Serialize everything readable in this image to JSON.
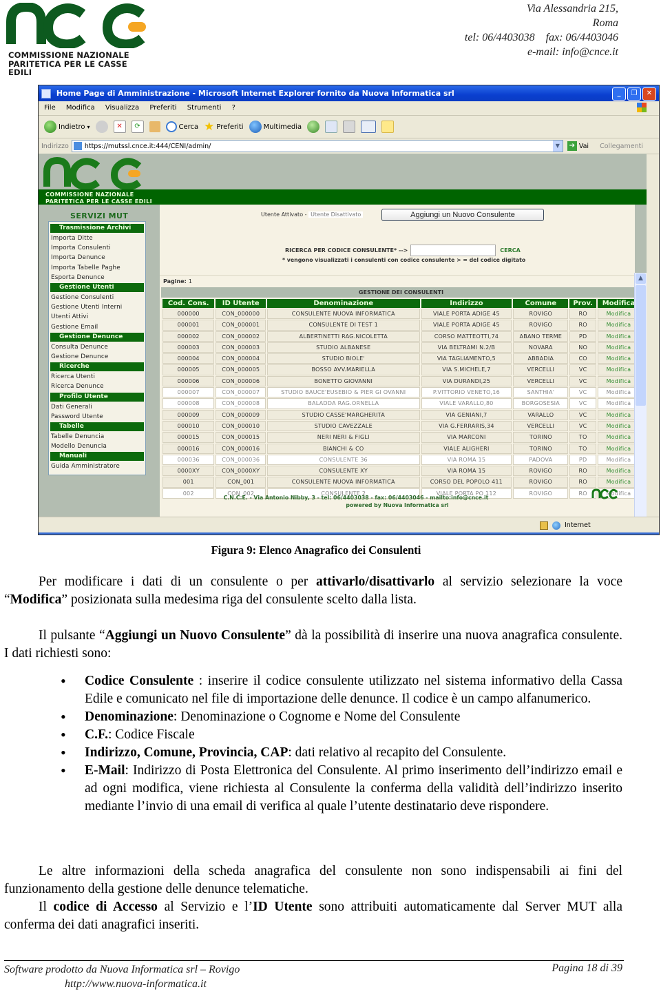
{
  "letterhead": {
    "org_line1": "COMMISSIONE NAZIONALE",
    "org_line2": "PARITETICA PER LE CASSE EDILI",
    "address_line1": "Via Alessandria 215,",
    "address_line2": "Roma",
    "phone_fax": "tel: 06/4403038    fax: 06/4403046",
    "email": "e-mail: info@cnce.it"
  },
  "browser": {
    "title": "Home Page di Amministrazione - Microsoft Internet Explorer fornito da Nuova Informatica srl",
    "menu": [
      "File",
      "Modifica",
      "Visualizza",
      "Preferiti",
      "Strumenti",
      "?"
    ],
    "toolbar": {
      "back": "Indietro",
      "search": "Cerca",
      "favorites": "Preferiti",
      "media": "Multimedia"
    },
    "address_label": "Indirizzo",
    "url": "https://mutssl.cnce.it:444/CENI/admin/",
    "go": "Vai",
    "links": "Collegamenti",
    "status_zone": "Internet"
  },
  "site": {
    "org_line1": "COMMISSIONE NAZIONALE",
    "org_line2": "PARITETICA PER LE CASSE EDILI",
    "sidebar_title": "SERVIZI MUT",
    "sidebar": [
      {
        "type": "head",
        "label": "Trasmissione Archivi"
      },
      {
        "type": "item",
        "label": "Importa Ditte"
      },
      {
        "type": "item",
        "label": "Importa Consulenti"
      },
      {
        "type": "item",
        "label": "Importa Denunce"
      },
      {
        "type": "item",
        "label": "Importa Tabelle Paghe"
      },
      {
        "type": "item",
        "label": "Esporta Denunce"
      },
      {
        "type": "head",
        "label": "Gestione Utenti"
      },
      {
        "type": "item",
        "label": "Gestione Consulenti"
      },
      {
        "type": "item",
        "label": "Gestione Utenti Interni"
      },
      {
        "type": "item",
        "label": "Utenti Attivi"
      },
      {
        "type": "item",
        "label": "Gestione Email"
      },
      {
        "type": "head",
        "label": "Gestione Denunce"
      },
      {
        "type": "item",
        "label": "Consulta Denunce"
      },
      {
        "type": "item",
        "label": "Gestione Denunce"
      },
      {
        "type": "head",
        "label": "Ricerche"
      },
      {
        "type": "item",
        "label": "Ricerca Utenti"
      },
      {
        "type": "item",
        "label": "Ricerca Denunce"
      },
      {
        "type": "head",
        "label": "Profilo Utente"
      },
      {
        "type": "item",
        "label": "Dati Generali"
      },
      {
        "type": "item",
        "label": "Password Utente"
      },
      {
        "type": "head",
        "label": "Tabelle"
      },
      {
        "type": "item",
        "label": "Tabelle Denuncia"
      },
      {
        "type": "item",
        "label": "Modello Denuncia"
      },
      {
        "type": "head",
        "label": "Manuali"
      },
      {
        "type": "item",
        "label": "Guida Amministratore"
      }
    ],
    "legend_active": "Utente Attivato",
    "legend_sep": " - ",
    "legend_inactive": "Utente Disattivato",
    "add_button": "Aggiungi un Nuovo Consulente",
    "search_label": "RICERCA PER CODICE CONSULENTE* -->",
    "search_value": "",
    "search_button": "CERCA",
    "search_note": "* vengono visualizzati i consulenti con codice consulente > = del codice digitato",
    "pages_label": "Pagine:",
    "pages_value": "1",
    "table_title": "GESTIONE DEI CONSULENTI",
    "columns": [
      "Cod. Cons.",
      "ID Utente",
      "Denominazione",
      "Indirizzo",
      "Comune",
      "Prov.",
      "Modifica"
    ],
    "rows": [
      {
        "active": true,
        "cells": [
          "000000",
          "CON_000000",
          "CONSULENTE NUOVA INFORMATICA",
          "VIALE PORTA ADIGE 45",
          "ROVIGO",
          "RO",
          "Modifica"
        ]
      },
      {
        "active": true,
        "cells": [
          "000001",
          "CON_000001",
          "CONSULENTE DI TEST 1",
          "VIALE PORTA ADIGE 45",
          "ROVIGO",
          "RO",
          "Modifica"
        ]
      },
      {
        "active": true,
        "cells": [
          "000002",
          "CON_000002",
          "ALBERTINETTI RAG.NICOLETTA",
          "CORSO MATTEOTTI,74",
          "ABANO TERME",
          "PD",
          "Modifica"
        ]
      },
      {
        "active": true,
        "cells": [
          "000003",
          "CON_000003",
          "STUDIO ALBANESE",
          "VIA BELTRAMI N.2/B",
          "NOVARA",
          "NO",
          "Modifica"
        ]
      },
      {
        "active": true,
        "cells": [
          "000004",
          "CON_000004",
          "STUDIO BIOLE'",
          "VIA TAGLIAMENTO,5",
          "ABBADIA",
          "CO",
          "Modifica"
        ]
      },
      {
        "active": true,
        "cells": [
          "000005",
          "CON_000005",
          "BOSSO AVV.MARIELLA",
          "VIA S.MICHELE,7",
          "VERCELLI",
          "VC",
          "Modifica"
        ]
      },
      {
        "active": true,
        "cells": [
          "000006",
          "CON_000006",
          "BONETTO GIOVANNI",
          "VIA DURANDI,25",
          "VERCELLI",
          "VC",
          "Modifica"
        ]
      },
      {
        "active": false,
        "cells": [
          "000007",
          "CON_000007",
          "STUDIO BAUCE'EUSEBIO & PIER GI OVANNI",
          "P.VITTORIO VENETO,16",
          "SANTHIA'",
          "VC",
          "Modifica"
        ]
      },
      {
        "active": false,
        "cells": [
          "000008",
          "CON_000008",
          "BALADDA RAG.ORNELLA",
          "VIALE VARALLO,80",
          "BORGOSESIA",
          "VC",
          "Modifica"
        ]
      },
      {
        "active": true,
        "cells": [
          "000009",
          "CON_000009",
          "STUDIO CASSE'MARGHERITA",
          "VIA GENIANI,7",
          "VARALLO",
          "VC",
          "Modifica"
        ]
      },
      {
        "active": true,
        "cells": [
          "000010",
          "CON_000010",
          "STUDIO CAVEZZALE",
          "VIA G.FERRARIS,34",
          "VERCELLI",
          "VC",
          "Modifica"
        ]
      },
      {
        "active": true,
        "cells": [
          "000015",
          "CON_000015",
          "NERI NERI & FIGLI",
          "VIA MARCONI",
          "TORINO",
          "TO",
          "Modifica"
        ]
      },
      {
        "active": true,
        "cells": [
          "000016",
          "CON_000016",
          "BIANCHI & CO",
          "VIALE ALIGHERI",
          "TORINO",
          "TO",
          "Modifica"
        ]
      },
      {
        "active": false,
        "cells": [
          "000036",
          "CON_000036",
          "CONSULENTE 36",
          "VIA ROMA 15",
          "PADOVA",
          "PD",
          "Modifica"
        ]
      },
      {
        "active": true,
        "cells": [
          "0000XY",
          "CON_0000XY",
          "CONSULENTE XY",
          "VIA ROMA 15",
          "ROVIGO",
          "RO",
          "Modifica"
        ]
      },
      {
        "active": true,
        "cells": [
          "001",
          "CON_001",
          "CONSULENTE NUOVA INFORMATICA",
          "CORSO DEL POPOLO 411",
          "ROVIGO",
          "RO",
          "Modifica"
        ]
      },
      {
        "active": false,
        "cells": [
          "002",
          "CON_002",
          "CONSULENTE 2",
          "VIALE PORTA PO 112",
          "ROVIGO",
          "RO",
          "Modifica"
        ]
      }
    ],
    "footer_line1": "C.N.C.E. - Via Antonio Nibby, 3 - tel: 06/4403038 - fax: 06/4403046 - mailto:info@cnce.it",
    "footer_line2": "powered by Nuova Informatica srl"
  },
  "document": {
    "caption": "Figura 9: Elenco Anagrafico dei Consulenti",
    "p1": [
      {
        "t": "Per modificare i dati di un consulente o per ",
        "b": false
      },
      {
        "t": "attivarlo/disattivarlo",
        "b": true
      },
      {
        "t": " al servizio selezionare la voce “",
        "b": false
      },
      {
        "t": "Modifica",
        "b": true
      },
      {
        "t": "” posizionata sulla medesima riga del consulente scelto dalla lista.",
        "b": false
      }
    ],
    "p2": [
      {
        "t": "Il pulsante “",
        "b": false
      },
      {
        "t": "Aggiungi un Nuovo Consulente",
        "b": true
      },
      {
        "t": "” dà la possibilità di inserire una nuova anagrafica consulente. I dati richiesti sono:",
        "b": false
      }
    ],
    "bullets": [
      {
        "term": "Codice Consulente",
        "text": " : inserire il codice consulente utilizzato nel sistema informativo della Cassa Edile e comunicato nel file di importazione delle denunce. Il codice è un campo alfanumerico."
      },
      {
        "term": "Denominazione",
        "text": ": Denominazione o Cognome e Nome del Consulente"
      },
      {
        "term": "C.F.",
        "text": ": Codice Fiscale"
      },
      {
        "term": "Indirizzo, Comune, Provincia, CAP",
        "text": ": dati relativo al recapito del Consulente."
      },
      {
        "term": "E-Mail",
        "text": ": Indirizzo di Posta Elettronica del Consulente. Al primo inserimento dell’indirizzo email e ad ogni modifica, viene richiesta al Consulente la conferma della validità dell’indirizzo inserito mediante l’invio di una email di verifica al quale l’utente destinatario deve rispondere."
      }
    ],
    "p3": [
      {
        "t": "Le altre informazioni della scheda anagrafica del consulente non sono indispensabili ai fini del funzionamento della gestione delle denunce telematiche.",
        "b": false
      }
    ],
    "p4": [
      {
        "t": "Il ",
        "b": false
      },
      {
        "t": "codice di Accesso",
        "b": true
      },
      {
        "t": " al Servizio e l’",
        "b": false
      },
      {
        "t": "ID Utente",
        "b": true
      },
      {
        "t": " sono attribuiti automaticamente dal Server MUT alla conferma dei dati anagrafici inseriti.",
        "b": false
      }
    ],
    "footer_left": "Software prodotto da Nuova Informatica srl – Rovigo",
    "footer_url": "http://www.nuova-informatica.it",
    "footer_page": "Pagina 18 di 39"
  },
  "colors": {
    "brand_green": "#006400",
    "brand_orange": "#f5a623",
    "ie_blue": "#0a3fcf",
    "link_green": "#2d8a2d"
  }
}
